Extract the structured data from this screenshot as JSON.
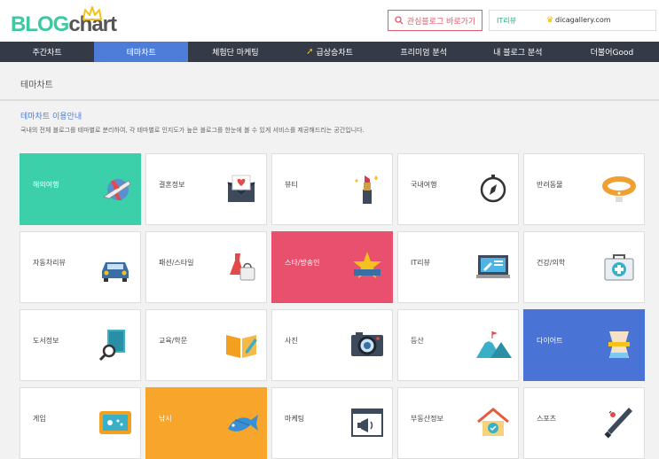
{
  "header": {
    "logo_blog": "BLOG",
    "logo_chart": "chart",
    "favorite_button": "관심블로그 바로가기",
    "user_category": "IT리뷰",
    "user_blog": "dicagallery.com"
  },
  "nav": {
    "items": [
      "주간차트",
      "테마차트",
      "체험단 마케팅",
      "급상승차트",
      "프리미엄 분석",
      "내 블로그 분석",
      "더불어Good"
    ]
  },
  "page": {
    "title": "테마차트",
    "info_title": "테마차트 이용안내",
    "info_desc": "국내의 전체 블로그를 테마별로 분리하여, 각 테마별로 인지도가 높은 블로그를 한눈에 볼 수 있게 서비스를 제공해드리는 공간입니다."
  },
  "themes": [
    {
      "label": "해외여행",
      "icon": "airplane-icon",
      "bg": "#3bcfaa"
    },
    {
      "label": "결혼정보",
      "icon": "love-letter-icon",
      "bg": ""
    },
    {
      "label": "뷰티",
      "icon": "lipstick-icon",
      "bg": ""
    },
    {
      "label": "국내여행",
      "icon": "compass-icon",
      "bg": ""
    },
    {
      "label": "반려동물",
      "icon": "dog-collar-icon",
      "bg": ""
    },
    {
      "label": "자동차리뷰",
      "icon": "car-icon",
      "bg": ""
    },
    {
      "label": "패션/스타일",
      "icon": "dress-bag-icon",
      "bg": ""
    },
    {
      "label": "스타/방송인",
      "icon": "star-icon",
      "bg": "#e8506e"
    },
    {
      "label": "IT리뷰",
      "icon": "monitor-icon",
      "bg": ""
    },
    {
      "label": "건강/의학",
      "icon": "first-aid-kit-icon",
      "bg": ""
    },
    {
      "label": "도서정보",
      "icon": "book-search-icon",
      "bg": ""
    },
    {
      "label": "교육/학문",
      "icon": "open-book-pencil-icon",
      "bg": ""
    },
    {
      "label": "사진",
      "icon": "camera-icon",
      "bg": ""
    },
    {
      "label": "등산",
      "icon": "mountain-icon",
      "bg": ""
    },
    {
      "label": "다이어트",
      "icon": "waist-measure-icon",
      "bg": "#4a73d6"
    },
    {
      "label": "게임",
      "icon": "game-screen-icon",
      "bg": ""
    },
    {
      "label": "낚시",
      "icon": "fish-icon",
      "bg": "#f7a62b"
    },
    {
      "label": "마케팅",
      "icon": "megaphone-window-icon",
      "bg": ""
    },
    {
      "label": "부동산정보",
      "icon": "house-check-icon",
      "bg": ""
    },
    {
      "label": "스포츠",
      "icon": "sports-bat-icon",
      "bg": ""
    }
  ]
}
